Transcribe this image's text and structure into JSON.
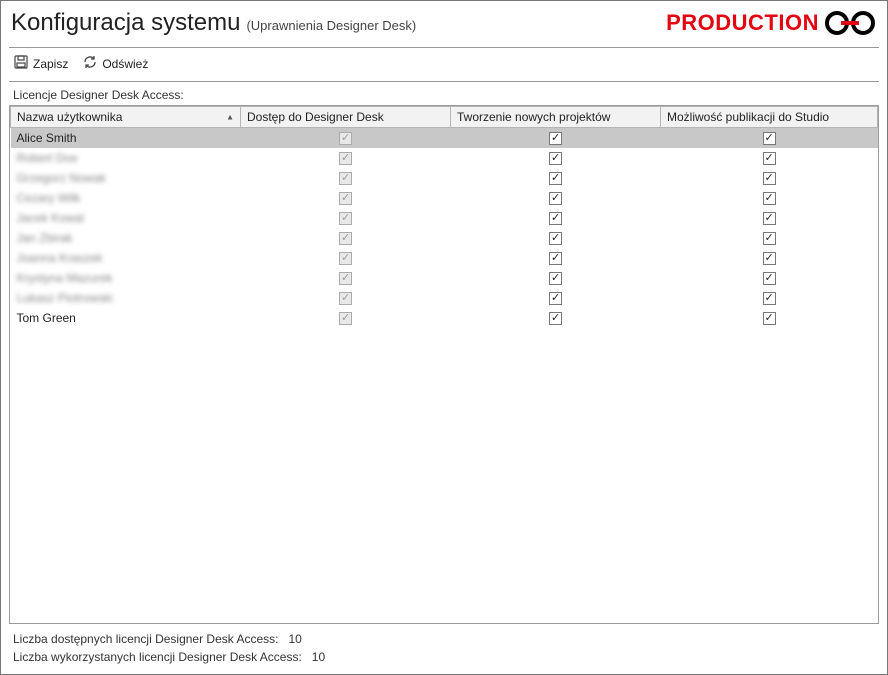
{
  "header": {
    "title": "Konfiguracja systemu",
    "subtitle": "(Uprawnienia Designer Desk)",
    "brand": "PRODUCTION"
  },
  "toolbar": {
    "save_label": "Zapisz",
    "refresh_label": "Odśwież"
  },
  "section_label": "Licencje Designer Desk Access:",
  "columns": {
    "user": "Nazwa użytkownika",
    "access": "Dostęp do Designer Desk",
    "create": "Tworzenie nowych projektów",
    "publish": "Możliwość publikacji do Studio"
  },
  "rows": [
    {
      "user": "Alice Smith",
      "blurred": false,
      "selected": true,
      "access": true,
      "access_disabled": true,
      "create": true,
      "publish": true
    },
    {
      "user": "Robert Doe",
      "blurred": true,
      "selected": false,
      "access": true,
      "access_disabled": true,
      "create": true,
      "publish": true
    },
    {
      "user": "Grzegorz Nowak",
      "blurred": true,
      "selected": false,
      "access": true,
      "access_disabled": true,
      "create": true,
      "publish": true
    },
    {
      "user": "Cezary Wilk",
      "blurred": true,
      "selected": false,
      "access": true,
      "access_disabled": true,
      "create": true,
      "publish": true
    },
    {
      "user": "Jacek Kowal",
      "blurred": true,
      "selected": false,
      "access": true,
      "access_disabled": true,
      "create": true,
      "publish": true
    },
    {
      "user": "Jan Zbirak",
      "blurred": true,
      "selected": false,
      "access": true,
      "access_disabled": true,
      "create": true,
      "publish": true
    },
    {
      "user": "Joanna Kraszek",
      "blurred": true,
      "selected": false,
      "access": true,
      "access_disabled": true,
      "create": true,
      "publish": true
    },
    {
      "user": "Krystyna Mazurek",
      "blurred": true,
      "selected": false,
      "access": true,
      "access_disabled": true,
      "create": true,
      "publish": true
    },
    {
      "user": "Lukasz Piotrowski",
      "blurred": true,
      "selected": false,
      "access": true,
      "access_disabled": true,
      "create": true,
      "publish": true
    },
    {
      "user": "Tom Green",
      "blurred": false,
      "selected": false,
      "access": true,
      "access_disabled": true,
      "create": true,
      "publish": true
    }
  ],
  "footer": {
    "available_label": "Liczba dostępnych licencji Designer Desk Access:",
    "available_value": "10",
    "used_label": "Liczba wykorzystanych licencji Designer Desk Access:",
    "used_value": "10"
  }
}
